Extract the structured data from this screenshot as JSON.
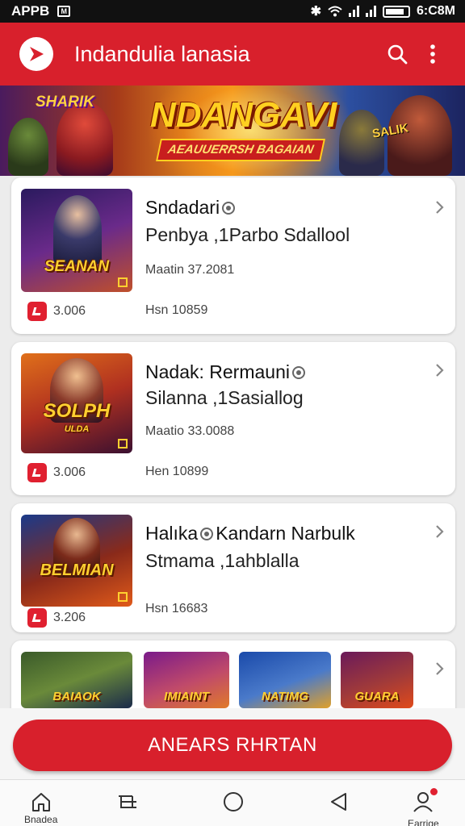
{
  "status_bar": {
    "left_label": "APPB",
    "small_icon": "M",
    "time": "6:C8M"
  },
  "app_bar": {
    "title": "Indandulia lanasia",
    "logo_icon": "play-arrow-logo-icon",
    "search_icon": "search-icon",
    "menu_icon": "more-vertical-icon"
  },
  "banner": {
    "tag": "SHARIK",
    "title": "NDANGAVI",
    "subtitle": "AEAUUERRSH BAGAIAN",
    "side_tag": "SALIK"
  },
  "cards": [
    {
      "title": "Sndadari",
      "subtitle": "Penbya ,1Parbo Sdallool",
      "meta": "Maatin 37.2081",
      "price": "3.006",
      "code": "Hsn 10859",
      "thumb_caption": "SEANAN",
      "thumb_colors": [
        "#2a1a5e",
        "#8a2a8a"
      ]
    },
    {
      "title_part1": "Nadak:",
      "title_part2": "Rermauni",
      "subtitle": "Silanna ,1Sasiallog",
      "meta": "Maatio 33.0088",
      "price": "3.006",
      "code": "Hen 10899",
      "thumb_caption": "SOLPH",
      "thumb_caption2": "ULDA",
      "thumb_colors": [
        "#e0701a",
        "#3a1030"
      ]
    },
    {
      "title_part1": "Halıka",
      "title_part2": "Kandarn Narbulk",
      "subtitle": "Stmama ,1ahblalla",
      "price": "3.206",
      "code": "Hsn 16683",
      "thumb_caption": "BELMIAN",
      "thumb_colors": [
        "#1a3a8a",
        "#e05a1a"
      ]
    }
  ],
  "strip": [
    {
      "caption": "BAIAOK",
      "colors": [
        "#3a5a2a",
        "#1a2a4a"
      ]
    },
    {
      "caption": "IMIAINT",
      "colors": [
        "#7a1a8a",
        "#e07a2a"
      ]
    },
    {
      "caption": "NATIMG",
      "colors": [
        "#1a4aaa",
        "#e0a02a"
      ]
    },
    {
      "caption": "GUARA",
      "colors": [
        "#6a1a5a",
        "#e04a1a"
      ]
    }
  ],
  "cta": {
    "label": "ANEARS RHRTAN"
  },
  "nav": [
    {
      "label": "Bnadea",
      "icon": "home-icon"
    },
    {
      "label": "",
      "icon": "recent-apps-icon"
    },
    {
      "label": "",
      "icon": "circle-home-icon"
    },
    {
      "label": "",
      "icon": "back-triangle-icon"
    },
    {
      "label": "Earrige",
      "icon": "profile-icon"
    }
  ],
  "colors": {
    "primary": "#d8202c",
    "background": "#ececec"
  }
}
